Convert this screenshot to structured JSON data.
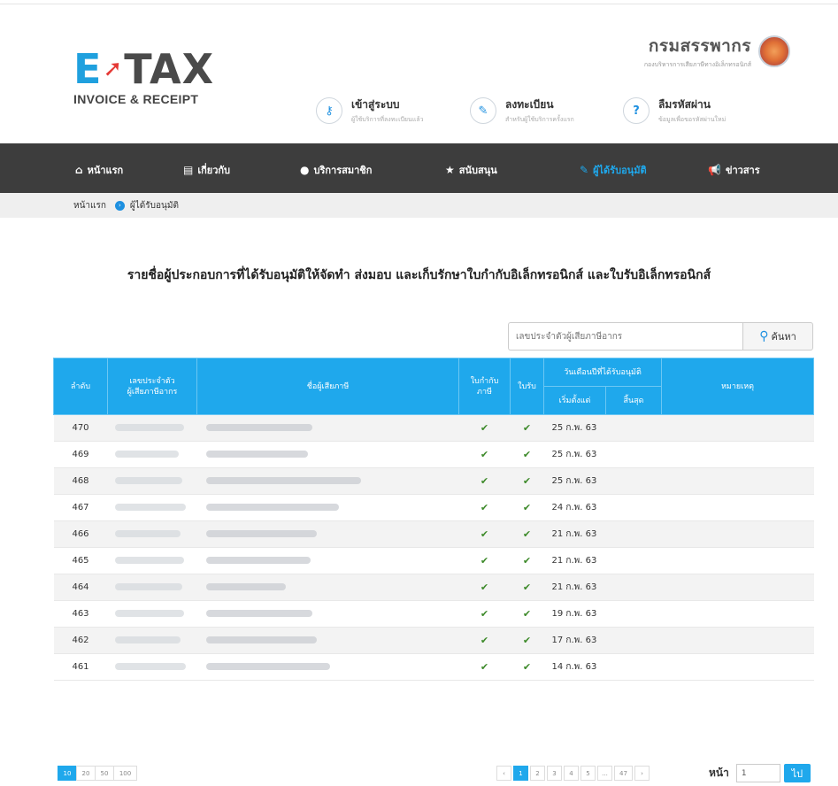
{
  "logo": {
    "mark_e": "E",
    "mark_rest": "TAX",
    "subtitle": "INVOICE & RECEIPT"
  },
  "department": {
    "name": "กรมสรรพากร",
    "sub": "กองบริหารการเสียภาษีทางอิเล็กทรอนิกส์"
  },
  "quick_links": [
    {
      "icon": "key-icon",
      "title": "เข้าสู่ระบบ",
      "sub": "ผู้ใช้บริการที่ลงทะเบียนแล้ว"
    },
    {
      "icon": "edit-icon",
      "title": "ลงทะเบียน",
      "sub": "สำหรับผู้ใช้บริการครั้งแรก"
    },
    {
      "icon": "question-icon",
      "title": "ลืมรหัสผ่าน",
      "sub": "ข้อมูลเพื่อขอรหัสผ่านใหม่"
    }
  ],
  "nav": [
    {
      "icon": "home-icon",
      "label": "หน้าแรก",
      "active": false
    },
    {
      "icon": "document-icon",
      "label": "เกี่ยวกับ",
      "active": false
    },
    {
      "icon": "user-icon",
      "label": "บริการสมาชิก",
      "active": false
    },
    {
      "icon": "star-icon",
      "label": "สนับสนุน",
      "active": false
    },
    {
      "icon": "approved-icon",
      "label": "ผู้ได้รับอนุมัติ",
      "active": true
    },
    {
      "icon": "megaphone-icon",
      "label": "ข่าวสาร",
      "active": false
    }
  ],
  "breadcrumb": {
    "home": "หน้าแรก",
    "current": "ผู้ได้รับอนุมัติ"
  },
  "title": "รายชื่อผู้ประกอบการที่ได้รับอนุมัติให้จัดทำ ส่งมอบ และเก็บรักษาใบกำกับอิเล็กทรอนิกส์ และใบรับอิเล็กทรอนิกส์",
  "search": {
    "placeholder": "เลขประจำตัวผู้เสียภาษีอากร",
    "button": "ค้นหา"
  },
  "table": {
    "headers": {
      "no": "ลำดับ",
      "taxid": "เลขประจำตัว\nผู้เสียภาษีอากร",
      "name": "ชื่อผู้เสียภาษี",
      "invoice": "ใบกำกับ\nภาษี",
      "receipt": "ใบรับ",
      "approved_date": "วันเดือนปีที่ได้รับอนุมัติ",
      "start": "เริ่มตั้งแต่",
      "end": "สิ้นสุด",
      "remark": "หมายเหตุ"
    },
    "rows": [
      {
        "no": "470",
        "invoice": "✔",
        "receipt": "✔",
        "start": "25 ก.พ. 63",
        "end": "",
        "remark": ""
      },
      {
        "no": "469",
        "invoice": "✔",
        "receipt": "✔",
        "start": "25 ก.พ. 63",
        "end": "",
        "remark": ""
      },
      {
        "no": "468",
        "invoice": "✔",
        "receipt": "✔",
        "start": "25 ก.พ. 63",
        "end": "",
        "remark": ""
      },
      {
        "no": "467",
        "invoice": "✔",
        "receipt": "✔",
        "start": "24 ก.พ. 63",
        "end": "",
        "remark": ""
      },
      {
        "no": "466",
        "invoice": "✔",
        "receipt": "✔",
        "start": "21 ก.พ. 63",
        "end": "",
        "remark": ""
      },
      {
        "no": "465",
        "invoice": "✔",
        "receipt": "✔",
        "start": "21 ก.พ. 63",
        "end": "",
        "remark": ""
      },
      {
        "no": "464",
        "invoice": "✔",
        "receipt": "✔",
        "start": "21 ก.พ. 63",
        "end": "",
        "remark": ""
      },
      {
        "no": "463",
        "invoice": "✔",
        "receipt": "✔",
        "start": "19 ก.พ. 63",
        "end": "",
        "remark": ""
      },
      {
        "no": "462",
        "invoice": "✔",
        "receipt": "✔",
        "start": "17 ก.พ. 63",
        "end": "",
        "remark": ""
      },
      {
        "no": "461",
        "invoice": "✔",
        "receipt": "✔",
        "start": "14 ก.พ. 63",
        "end": "",
        "remark": ""
      }
    ]
  },
  "page_sizes": [
    "10",
    "20",
    "50",
    "100"
  ],
  "page_size_selected": "10",
  "pagination": {
    "prev": "‹",
    "pages": [
      "1",
      "2",
      "3",
      "4",
      "5",
      "...",
      "47"
    ],
    "next": "›",
    "current": "1"
  },
  "goto": {
    "label": "หน้า",
    "value": "1",
    "button": "ไป"
  },
  "colors": {
    "accent": "#1fa8ec",
    "nav_bg": "#3d3d3d",
    "check": "#3d8a2a",
    "logo_e": "#1fa0de",
    "logo_arrow": "#e53935"
  }
}
